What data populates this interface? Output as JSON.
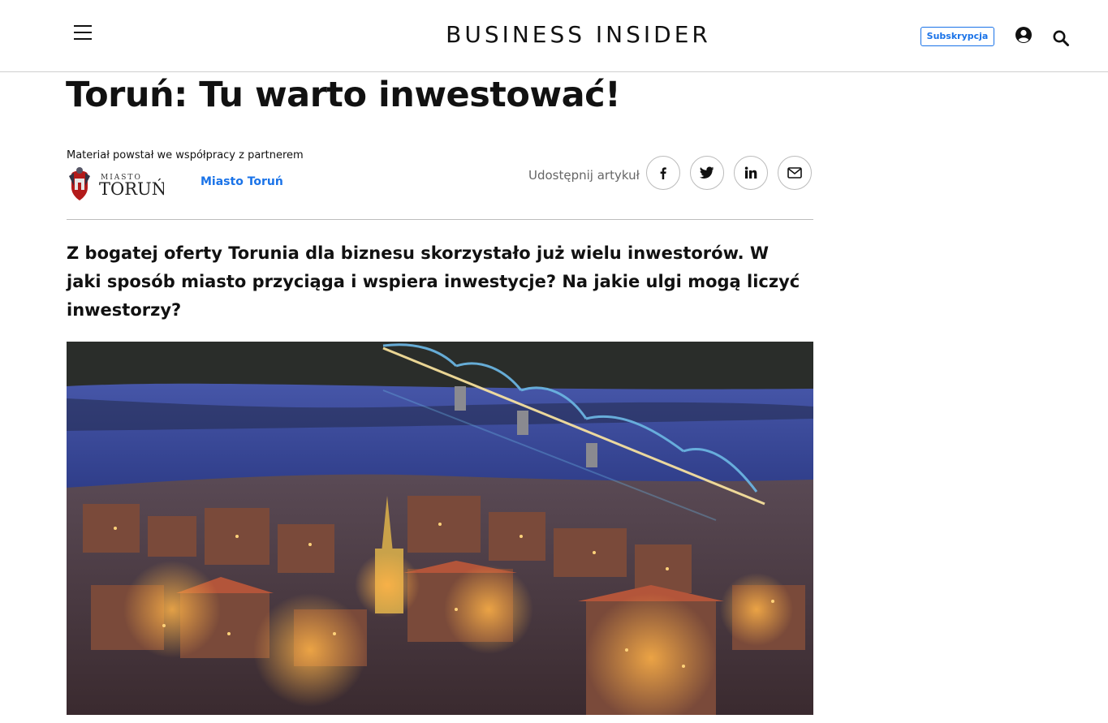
{
  "header": {
    "logo": "BUSINESS INSIDER",
    "subscribe_label": "Subskrypcja",
    "icons": [
      "menu-icon",
      "user-icon",
      "search-icon"
    ]
  },
  "article": {
    "title": "Toruń: Tu warto inwestować!",
    "partner_note": "Materiał powstał we współpracy z partnerem",
    "partner_logo_text": "MIASTO TORUŃ",
    "partner_name": "Miasto Toruń",
    "share_label": "Udostępnij artykuł",
    "share_icons": [
      "facebook-icon",
      "twitter-icon",
      "linkedin-icon",
      "email-icon"
    ],
    "lead": "Z bogatej oferty Torunia dla biznesu skorzystało już wielu inwestorów. W jaki sposób miasto przyciąga i wspiera inwestycje? Na jakie ulgi mogą liczyć inwestorzy?"
  },
  "colors": {
    "accent": "#1a73e8",
    "text": "#111111",
    "divider": "#bdbdbd"
  }
}
